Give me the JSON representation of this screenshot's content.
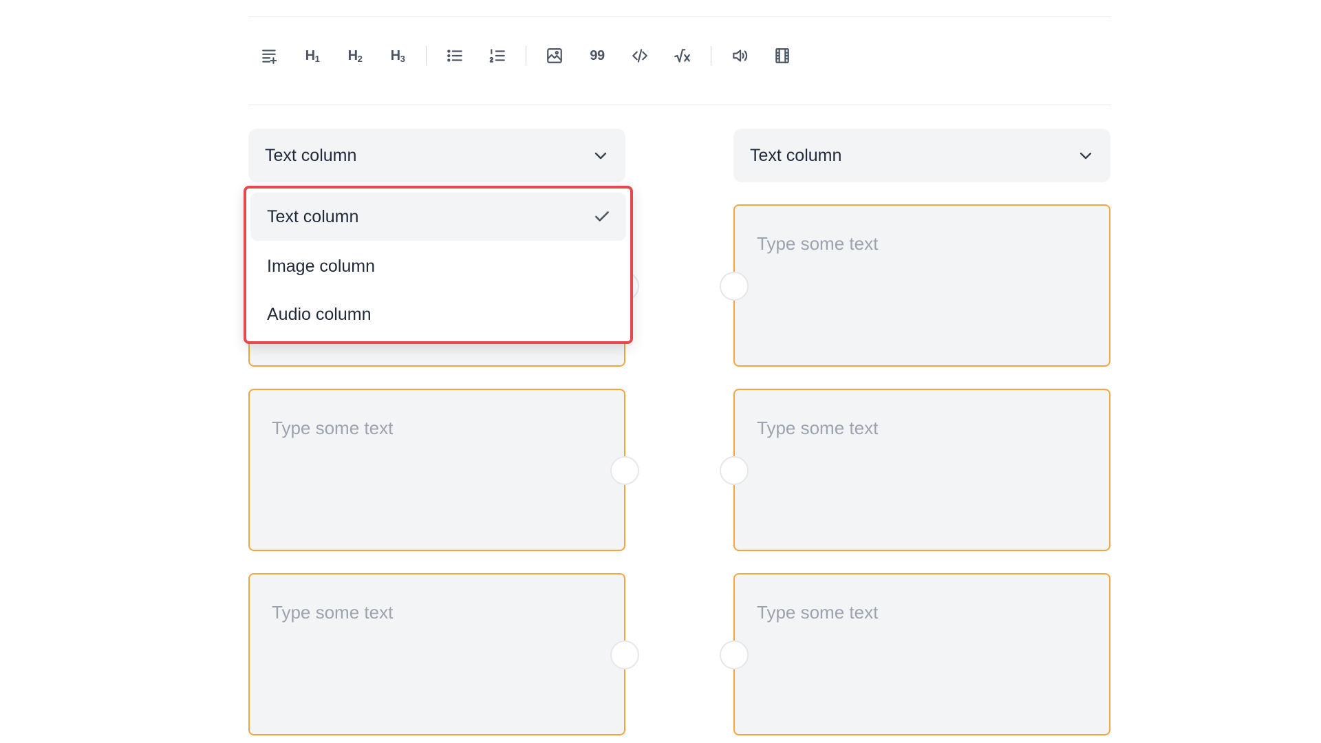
{
  "toolbar": {
    "items": [
      {
        "icon": "paragraph-icon"
      },
      {
        "label": "H",
        "sub": "1"
      },
      {
        "label": "H",
        "sub": "2"
      },
      {
        "label": "H",
        "sub": "3"
      },
      {
        "icon": "bullet-list-icon"
      },
      {
        "icon": "numbered-list-icon"
      },
      {
        "icon": "image-icon"
      },
      {
        "label": "99",
        "icon": "quote-icon"
      },
      {
        "icon": "code-icon"
      },
      {
        "icon": "formula-icon"
      },
      {
        "icon": "audio-icon"
      },
      {
        "icon": "video-icon"
      }
    ]
  },
  "left_column": {
    "select_value": "Text column"
  },
  "right_column": {
    "select_value": "Text column"
  },
  "dropdown": {
    "options": [
      "Text column",
      "Image column",
      "Audio column"
    ],
    "selected": "Text column",
    "highlight_color": "#e5484d"
  },
  "cards": {
    "placeholder": "Type some text",
    "border_color": "#f5a53c"
  }
}
